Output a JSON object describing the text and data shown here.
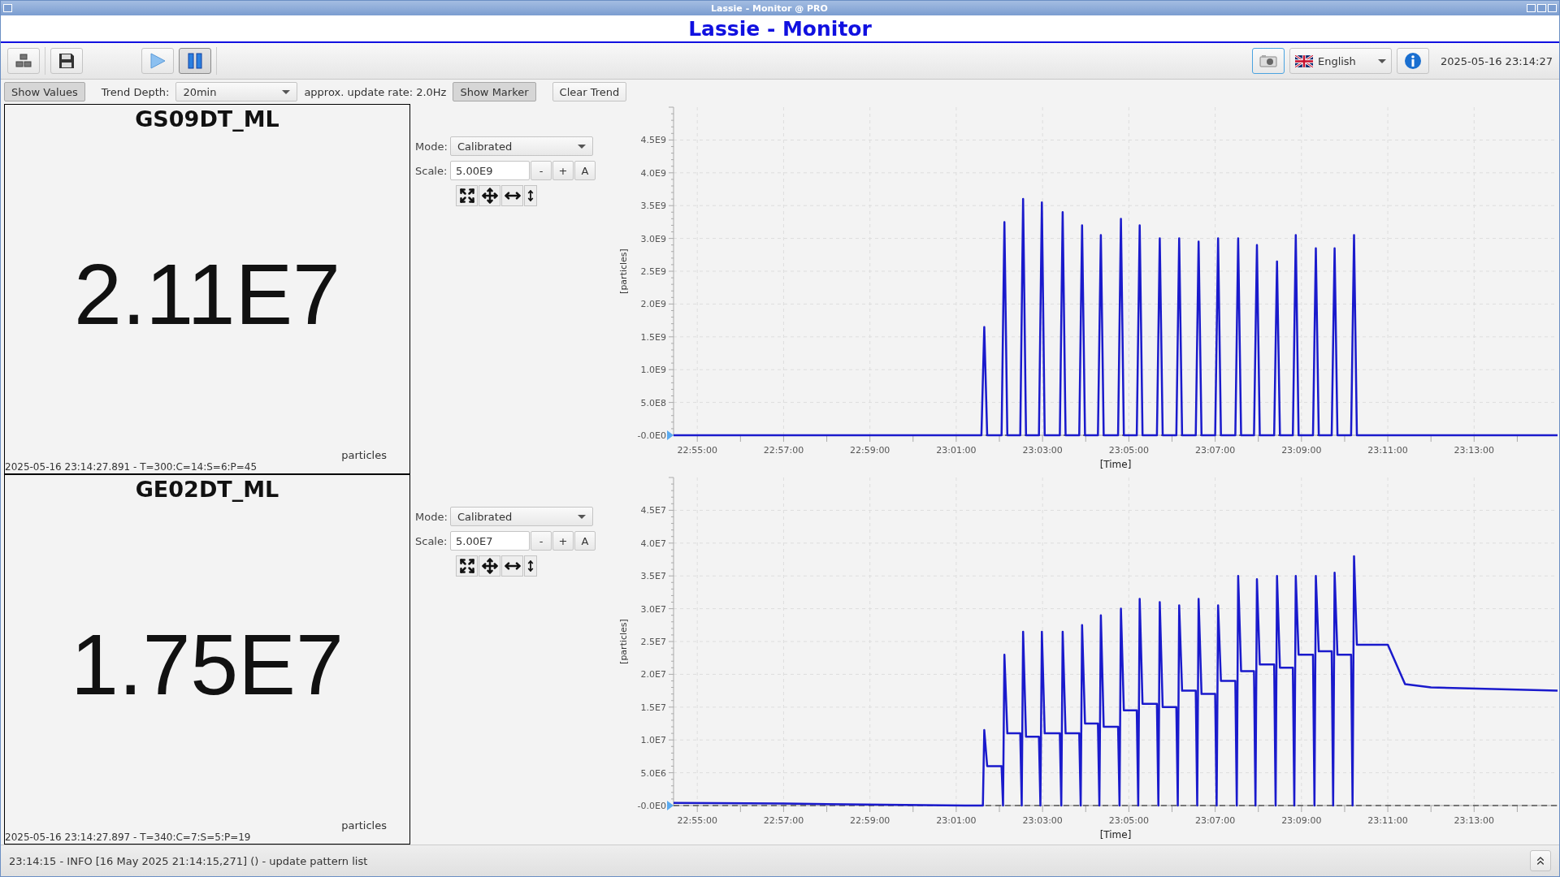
{
  "window": {
    "title": "Lassie - Monitor @ PRO"
  },
  "app_title": "Lassie - Monitor",
  "toolbar": {
    "left": [
      {
        "kind": "tree",
        "active": false
      },
      {
        "kind": "save",
        "active": false
      },
      {
        "kind": "play",
        "active": false
      },
      {
        "kind": "pause",
        "active": true
      }
    ],
    "language": "English",
    "clock": "2025-05-16 23:14:27"
  },
  "controls": {
    "show_values": {
      "label": "Show Values",
      "pressed": true
    },
    "trend_depth_label": "Trend Depth:",
    "trend_depth": "20min",
    "update_rate_label": "approx. update rate:",
    "update_rate": "2.0Hz",
    "show_marker": {
      "label": "Show Marker",
      "pressed": true
    },
    "clear_trend": {
      "label": "Clear Trend",
      "pressed": false
    }
  },
  "monitors": [
    {
      "name": "GS09DT_ML",
      "value": "2.11E7",
      "unit": "particles",
      "footer": "2025-05-16 23:14:27.891 - T=300:C=14:S=6:P=45",
      "mode_label": "Mode:",
      "mode": "Calibrated",
      "scale_label": "Scale:",
      "scale": "5.00E9",
      "scale_buttons": [
        "-",
        "+",
        "A"
      ],
      "chart_data": {
        "type": "line",
        "grid": true,
        "xlabel": "[Time]",
        "ylabel": "[particles]",
        "xlim": [
          82467,
          83696
        ],
        "ylim": [
          0,
          5000000000.0
        ],
        "xticks": [
          {
            "value": 82500,
            "label": "22:55:00"
          },
          {
            "value": 82620,
            "label": "22:57:00"
          },
          {
            "value": 82740,
            "label": "22:59:00"
          },
          {
            "value": 82860,
            "label": "23:01:00"
          },
          {
            "value": 82980,
            "label": "23:03:00"
          },
          {
            "value": 83100,
            "label": "23:05:00"
          },
          {
            "value": 83220,
            "label": "23:07:00"
          },
          {
            "value": 83340,
            "label": "23:09:00"
          },
          {
            "value": 83460,
            "label": "23:11:00"
          },
          {
            "value": 83580,
            "label": "23:13:00"
          }
        ],
        "yticks": [
          {
            "value": 0,
            "label": "-0.0E0"
          },
          {
            "value": 500000000.0,
            "label": "5.0E8"
          },
          {
            "value": 1000000000.0,
            "label": "1.0E9"
          },
          {
            "value": 1500000000.0,
            "label": "1.5E9"
          },
          {
            "value": 2000000000.0,
            "label": "2.0E9"
          },
          {
            "value": 2500000000.0,
            "label": "2.5E9"
          },
          {
            "value": 3000000000.0,
            "label": "3.0E9"
          },
          {
            "value": 3500000000.0,
            "label": "3.5E9"
          },
          {
            "value": 4000000000.0,
            "label": "4.0E9"
          },
          {
            "value": 4500000000.0,
            "label": "4.5E9"
          }
        ],
        "x": [
          82467,
          82895,
          82899,
          82903,
          82923,
          82927,
          82931,
          82949,
          82953,
          82957,
          82975,
          82979,
          82983,
          83004,
          83008,
          83012,
          83031,
          83035,
          83039,
          83057,
          83061,
          83065,
          83085,
          83089,
          83093,
          83111,
          83115,
          83119,
          83139,
          83143,
          83147,
          83166,
          83170,
          83174,
          83193,
          83197,
          83201,
          83220,
          83224,
          83228,
          83248,
          83252,
          83256,
          83274,
          83278,
          83282,
          83302,
          83306,
          83310,
          83328,
          83332,
          83336,
          83356,
          83360,
          83364,
          83382,
          83386,
          83390,
          83409,
          83413,
          83417,
          83696
        ],
        "series": [
          {
            "color": "#1a1acc",
            "values": [
              0,
              0,
              1650000000.0,
              0,
              0,
              3250000000.0,
              0,
              0,
              3600000000.0,
              0,
              0,
              3550000000.0,
              0,
              0,
              3400000000.0,
              0,
              0,
              3200000000.0,
              0,
              0,
              3050000000.0,
              0,
              0,
              3300000000.0,
              0,
              0,
              3200000000.0,
              0,
              0,
              3000000000.0,
              0,
              0,
              3000000000.0,
              0,
              0,
              2950000000.0,
              0,
              0,
              3000000000.0,
              0,
              0,
              3000000000.0,
              0,
              0,
              2900000000.0,
              0,
              0,
              2650000000.0,
              0,
              0,
              3050000000.0,
              0,
              0,
              2850000000.0,
              0,
              0,
              2850000000.0,
              0,
              0,
              3050000000.0,
              0,
              0
            ]
          }
        ]
      }
    },
    {
      "name": "GE02DT_ML",
      "value": "1.75E7",
      "unit": "particles",
      "footer": "2025-05-16 23:14:27.897 - T=340:C=7:S=5:P=19",
      "mode_label": "Mode:",
      "mode": "Calibrated",
      "scale_label": "Scale:",
      "scale": "5.00E7",
      "scale_buttons": [
        "-",
        "+",
        "A"
      ],
      "chart_data": {
        "type": "line",
        "grid": true,
        "xlabel": "[Time]",
        "ylabel": "[particles]",
        "xlim": [
          82467,
          83696
        ],
        "ylim": [
          0,
          50000000.0
        ],
        "xticks": [
          {
            "value": 82500,
            "label": "22:55:00"
          },
          {
            "value": 82620,
            "label": "22:57:00"
          },
          {
            "value": 82740,
            "label": "22:59:00"
          },
          {
            "value": 82860,
            "label": "23:01:00"
          },
          {
            "value": 82980,
            "label": "23:03:00"
          },
          {
            "value": 83100,
            "label": "23:05:00"
          },
          {
            "value": 83220,
            "label": "23:07:00"
          },
          {
            "value": 83340,
            "label": "23:09:00"
          },
          {
            "value": 83460,
            "label": "23:11:00"
          },
          {
            "value": 83580,
            "label": "23:13:00"
          }
        ],
        "yticks": [
          {
            "value": 0,
            "label": "-0.0E0"
          },
          {
            "value": 5000000.0,
            "label": "5.0E6"
          },
          {
            "value": 10000000.0,
            "label": "1.0E7"
          },
          {
            "value": 15000000.0,
            "label": "1.5E7"
          },
          {
            "value": 20000000.0,
            "label": "2.0E7"
          },
          {
            "value": 25000000.0,
            "label": "2.5E7"
          },
          {
            "value": 30000000.0,
            "label": "3.0E7"
          },
          {
            "value": 35000000.0,
            "label": "3.5E7"
          },
          {
            "value": 40000000.0,
            "label": "4.0E7"
          },
          {
            "value": 45000000.0,
            "label": "4.5E7"
          }
        ],
        "x": [
          82467,
          82620,
          82872,
          82895,
          82897,
          82899,
          82903,
          82923,
          82925,
          82927,
          82931,
          82949,
          82951,
          82953,
          82957,
          82975,
          82977,
          82979,
          82983,
          83004,
          83006,
          83008,
          83012,
          83031,
          83033,
          83035,
          83039,
          83057,
          83059,
          83061,
          83065,
          83085,
          83087,
          83089,
          83093,
          83111,
          83113,
          83115,
          83119,
          83139,
          83141,
          83143,
          83147,
          83166,
          83168,
          83170,
          83174,
          83193,
          83195,
          83197,
          83201,
          83220,
          83222,
          83224,
          83228,
          83248,
          83250,
          83252,
          83256,
          83274,
          83276,
          83278,
          83282,
          83302,
          83304,
          83306,
          83310,
          83328,
          83330,
          83332,
          83336,
          83356,
          83358,
          83360,
          83364,
          83382,
          83384,
          83386,
          83390,
          83409,
          83411,
          83413,
          83417,
          83460,
          83484,
          83520,
          83696
        ],
        "series": [
          {
            "color": "#1a1acc",
            "values": [
              400000.0,
              300000.0,
              0,
              0,
              0,
              11500000.0,
              6000000.0,
              6000000.0,
              0,
              23000000.0,
              11000000.0,
              11000000.0,
              0,
              26500000.0,
              10500000.0,
              10500000.0,
              0,
              26500000.0,
              11000000.0,
              11000000.0,
              0,
              26500000.0,
              11000000.0,
              11000000.0,
              0,
              27500000.0,
              12500000.0,
              12500000.0,
              0,
              29000000.0,
              12000000.0,
              12000000.0,
              0,
              30000000.0,
              14500000.0,
              14500000.0,
              0,
              31500000.0,
              15500000.0,
              15500000.0,
              0,
              31000000.0,
              15000000.0,
              15000000.0,
              0,
              30500000.0,
              17500000.0,
              17500000.0,
              0,
              31500000.0,
              17000000.0,
              17000000.0,
              0,
              30500000.0,
              19000000.0,
              19000000.0,
              0,
              35000000.0,
              20500000.0,
              20500000.0,
              0,
              34500000.0,
              21500000.0,
              21500000.0,
              0,
              35000000.0,
              21000000.0,
              21000000.0,
              0,
              35000000.0,
              23000000.0,
              23000000.0,
              0,
              35000000.0,
              23500000.0,
              23500000.0,
              0,
              35500000.0,
              23000000.0,
              23000000.0,
              0,
              38000000.0,
              24500000.0,
              24500000.0,
              18500000.0,
              18000000.0,
              17500000.0
            ]
          }
        ]
      }
    }
  ],
  "status_bar": {
    "message": "23:14:15 -  INFO [16 May 2025 21:14:15,271] () - update pattern list"
  }
}
